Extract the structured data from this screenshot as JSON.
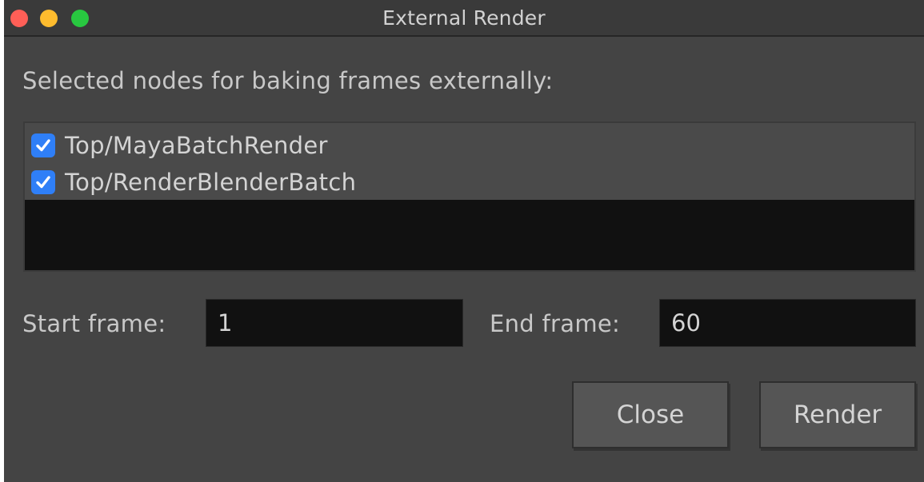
{
  "window": {
    "title": "External Render"
  },
  "main": {
    "section_label": "Selected nodes for baking frames externally:",
    "nodes": [
      {
        "label": "Top/MayaBatchRender",
        "checked": true
      },
      {
        "label": "Top/RenderBlenderBatch",
        "checked": true
      }
    ],
    "start_frame_label": "Start frame:",
    "start_frame_value": "1",
    "end_frame_label": "End frame:",
    "end_frame_value": "60"
  },
  "buttons": {
    "close_label": "Close",
    "render_label": "Render"
  },
  "colors": {
    "window_bg": "#444444",
    "field_bg": "#111111",
    "checkbox_accent": "#2f7ff7",
    "traffic_close": "#ff5f57",
    "traffic_minimize": "#febc2e",
    "traffic_zoom": "#28c840"
  }
}
